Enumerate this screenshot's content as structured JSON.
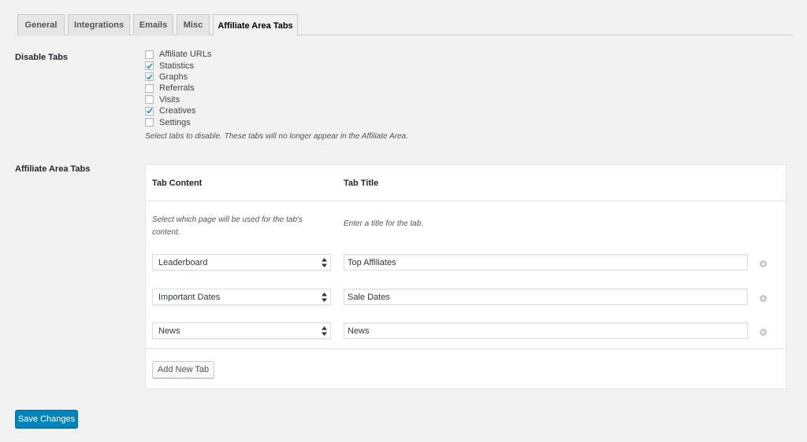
{
  "tabs": [
    {
      "label": "General",
      "active": false
    },
    {
      "label": "Integrations",
      "active": false
    },
    {
      "label": "Emails",
      "active": false
    },
    {
      "label": "Misc",
      "active": false
    },
    {
      "label": "Affiliate Area Tabs",
      "active": true
    }
  ],
  "disable_tabs": {
    "label": "Disable Tabs",
    "options": [
      {
        "label": "Affiliate URLs",
        "checked": false
      },
      {
        "label": "Statistics",
        "checked": true
      },
      {
        "label": "Graphs",
        "checked": true
      },
      {
        "label": "Referrals",
        "checked": false
      },
      {
        "label": "Visits",
        "checked": false
      },
      {
        "label": "Creatives",
        "checked": true
      },
      {
        "label": "Settings",
        "checked": false
      }
    ],
    "description": "Select tabs to disable. These tabs will no longer appear in the Affiliate Area."
  },
  "affiliate_area_tabs": {
    "label": "Affiliate Area Tabs",
    "col_content": "Tab Content",
    "col_title": "Tab Title",
    "content_hint_1": "Select which page will be used for the tab's",
    "content_hint_2": "content.",
    "title_hint": "Enter a title for the tab.",
    "rows": [
      {
        "page": "Leaderboard",
        "title": "Top Affiliates"
      },
      {
        "page": "Important Dates",
        "title": "Sale Dates"
      },
      {
        "page": "News",
        "title": "News"
      }
    ],
    "add_button": "Add New Tab"
  },
  "save_button": "Save Changes",
  "colors": {
    "primary": "#0085ba",
    "checkmark": "#1e8cbe",
    "background": "#f1f1f1"
  }
}
